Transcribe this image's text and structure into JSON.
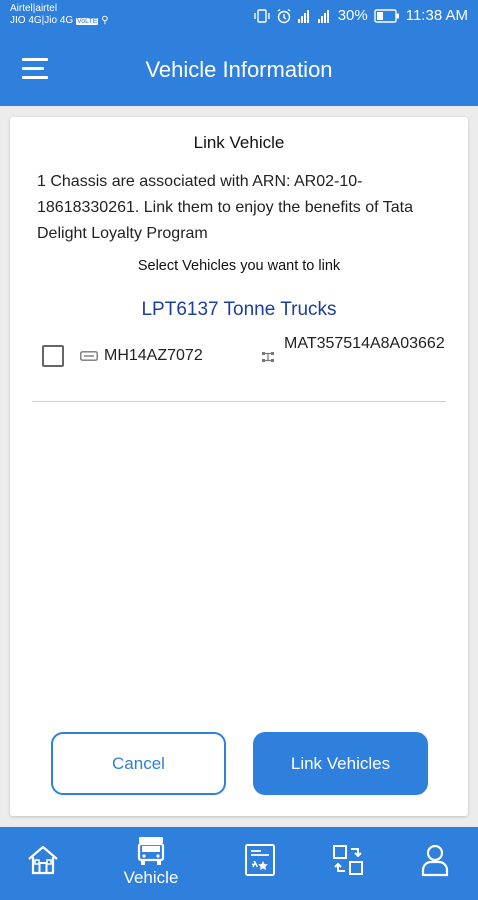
{
  "status_bar": {
    "carrier_line1": "Airtel|airtel",
    "carrier_line2": "JIO 4G|Jio 4G",
    "volte": "VoLTE",
    "battery": "30%",
    "time": "11:38 AM"
  },
  "app_bar": {
    "title": "Vehicle Information",
    "menu_icon": "hamburger-menu-icon"
  },
  "card": {
    "title": "Link Vehicle",
    "description": "1 Chassis are associated with ARN: AR02-10-18618330261. Link them to enjoy the benefits of Tata Delight Loyalty Program",
    "select_prompt": "Select Vehicles you want to link",
    "group_title": "LPT6137 Tonne Trucks",
    "vehicles": [
      {
        "checked": false,
        "registration": "MH14AZ7072",
        "chassis": "MAT357514A8A03662"
      }
    ],
    "cancel_label": "Cancel",
    "link_label": "Link Vehicles"
  },
  "bottom_nav": {
    "items": [
      {
        "icon": "home-icon",
        "label": ""
      },
      {
        "icon": "truck-icon",
        "label": "Vehicle",
        "active": true
      },
      {
        "icon": "card-icon",
        "label": ""
      },
      {
        "icon": "exchange-icon",
        "label": ""
      },
      {
        "icon": "user-icon",
        "label": ""
      }
    ]
  },
  "colors": {
    "primary": "#2f7fdc",
    "group_title": "#1d3f9c",
    "background": "#ececec"
  }
}
